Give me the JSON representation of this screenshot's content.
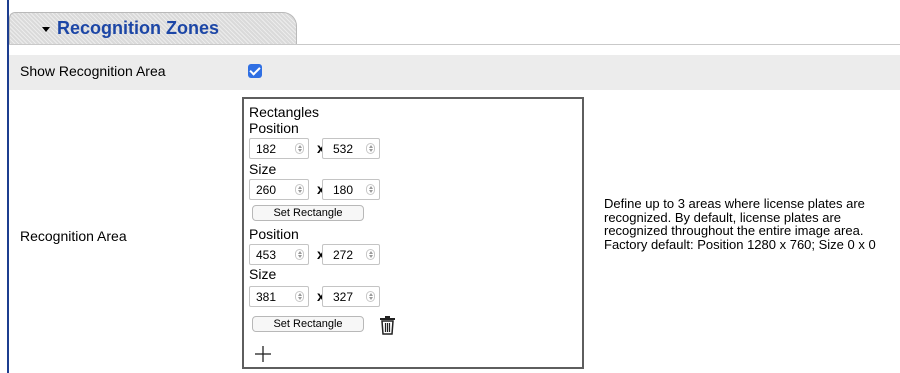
{
  "section": {
    "title": "Recognition Zones"
  },
  "show_area": {
    "label": "Show Recognition Area",
    "checked": true
  },
  "recognition_area": {
    "label": "Recognition Area",
    "shape_heading": "Rectangles",
    "rectangles": [
      {
        "position_label": "Position",
        "pos_x": "182",
        "pos_y": "532",
        "size_label": "Size",
        "size_w": "260",
        "size_h": "180",
        "button": "Set Rectangle"
      },
      {
        "position_label": "Position",
        "pos_x": "453",
        "pos_y": "272",
        "size_label": "Size",
        "size_w": "381",
        "size_h": "327",
        "button": "Set Rectangle"
      }
    ],
    "separator": "x",
    "add_icon": "plus-icon",
    "delete_icon": "trash-icon"
  },
  "help_text": "Define up to 3 areas where license plates are recognized. By default, license plates are recognized throughout the entire image area. Factory default: Position 1280 x 760; Size 0 x 0",
  "colors": {
    "accent": "#1c46a6",
    "checkbox": "#2f6fe3",
    "row_bg": "#ececec"
  }
}
